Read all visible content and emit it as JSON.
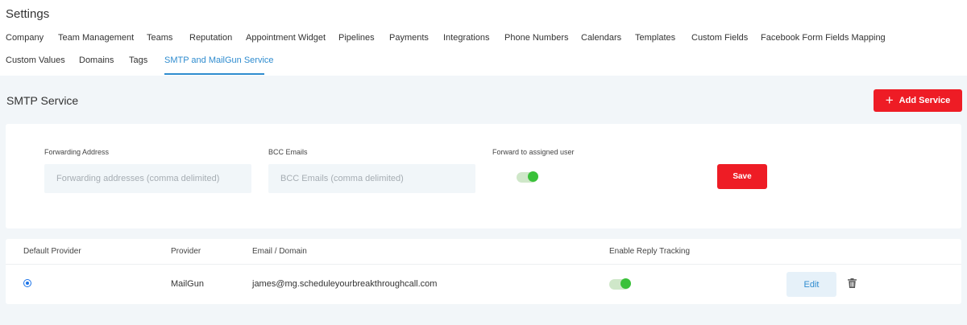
{
  "page": {
    "title": "Settings"
  },
  "tabs": [
    {
      "label": "Company"
    },
    {
      "label": "Team Management"
    },
    {
      "label": "Teams"
    },
    {
      "label": "Reputation"
    },
    {
      "label": "Appointment Widget"
    },
    {
      "label": "Pipelines"
    },
    {
      "label": "Payments"
    },
    {
      "label": "Integrations"
    },
    {
      "label": "Phone Numbers"
    },
    {
      "label": "Calendars"
    },
    {
      "label": "Templates"
    },
    {
      "label": "Custom Fields"
    },
    {
      "label": "Facebook Form Fields Mapping"
    },
    {
      "label": "Custom Values"
    },
    {
      "label": "Domains"
    },
    {
      "label": "Tags"
    },
    {
      "label": "SMTP and MailGun Service",
      "active": true
    }
  ],
  "smtp": {
    "title": "SMTP Service",
    "add_button": {
      "label": "Add Service",
      "icon": "plus-icon"
    },
    "forwarding": {
      "label": "Forwarding Address",
      "value": "",
      "placeholder": "Forwarding addresses (comma delimited)"
    },
    "bcc": {
      "label": "BCC Emails",
      "value": "",
      "placeholder": "BCC Emails (comma delimited)"
    },
    "forward_assigned": {
      "label": "Forward to assigned user",
      "enabled": true
    },
    "save_label": "Save"
  },
  "table": {
    "headers": [
      "Default Provider",
      "Provider",
      "Email / Domain",
      "Enable Reply Tracking"
    ],
    "rows": [
      {
        "default": true,
        "provider": "MailGun",
        "email": "james@mg.scheduleyourbreakthroughcall.com",
        "reply_tracking": true,
        "edit_label": "Edit",
        "delete_icon": "trash-icon"
      }
    ]
  },
  "colors": {
    "accent": "#2f8ccf",
    "primary_red": "#ee1c25",
    "toggle_on": "#3ac13a",
    "background": "#f2f6f9"
  }
}
